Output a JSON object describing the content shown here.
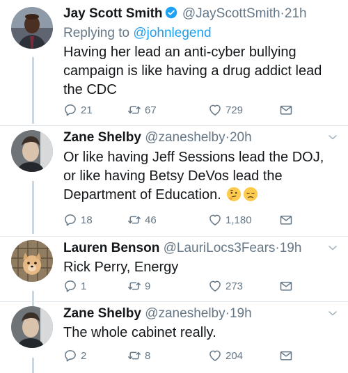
{
  "tweets": [
    {
      "name": "Jay Scott Smith",
      "verified": true,
      "handle": "@JayScottSmith",
      "dot": "·",
      "time": "21h",
      "reply_prefix": "Replying to ",
      "reply_handle": "@johnlegend",
      "text": "Having her lead an anti-cyber bullying campaign is like having a drug addict lead the CDC",
      "replies": "21",
      "retweets": "67",
      "likes": "729"
    },
    {
      "name": "Zane Shelby",
      "handle": "@zaneshelby",
      "dot": "·",
      "time": "20h",
      "text": "Or like having Jeff Sessions lead the DOJ, or like having Betsy DeVos lead the Department of Education.",
      "emojis": [
        "thinking-face",
        "disappointed-face"
      ],
      "replies": "18",
      "retweets": "46",
      "likes": "1,180"
    },
    {
      "name": "Lauren Benson",
      "handle": "@LauriLocs3Fears",
      "dot": "·",
      "time": "19h",
      "text": "Rick Perry, Energy",
      "replies": "1",
      "retweets": "9",
      "likes": "273"
    },
    {
      "name": "Zane Shelby",
      "handle": "@zaneshelby",
      "dot": "·",
      "time": "19h",
      "text": "The whole cabinet really.",
      "replies": "2",
      "retweets": "8",
      "likes": "204"
    }
  ],
  "colors": {
    "text": "#14171a",
    "muted": "#657786",
    "link": "#1da1f2",
    "divider": "#e1e8ed",
    "thread_line": "#ccd6dd"
  }
}
